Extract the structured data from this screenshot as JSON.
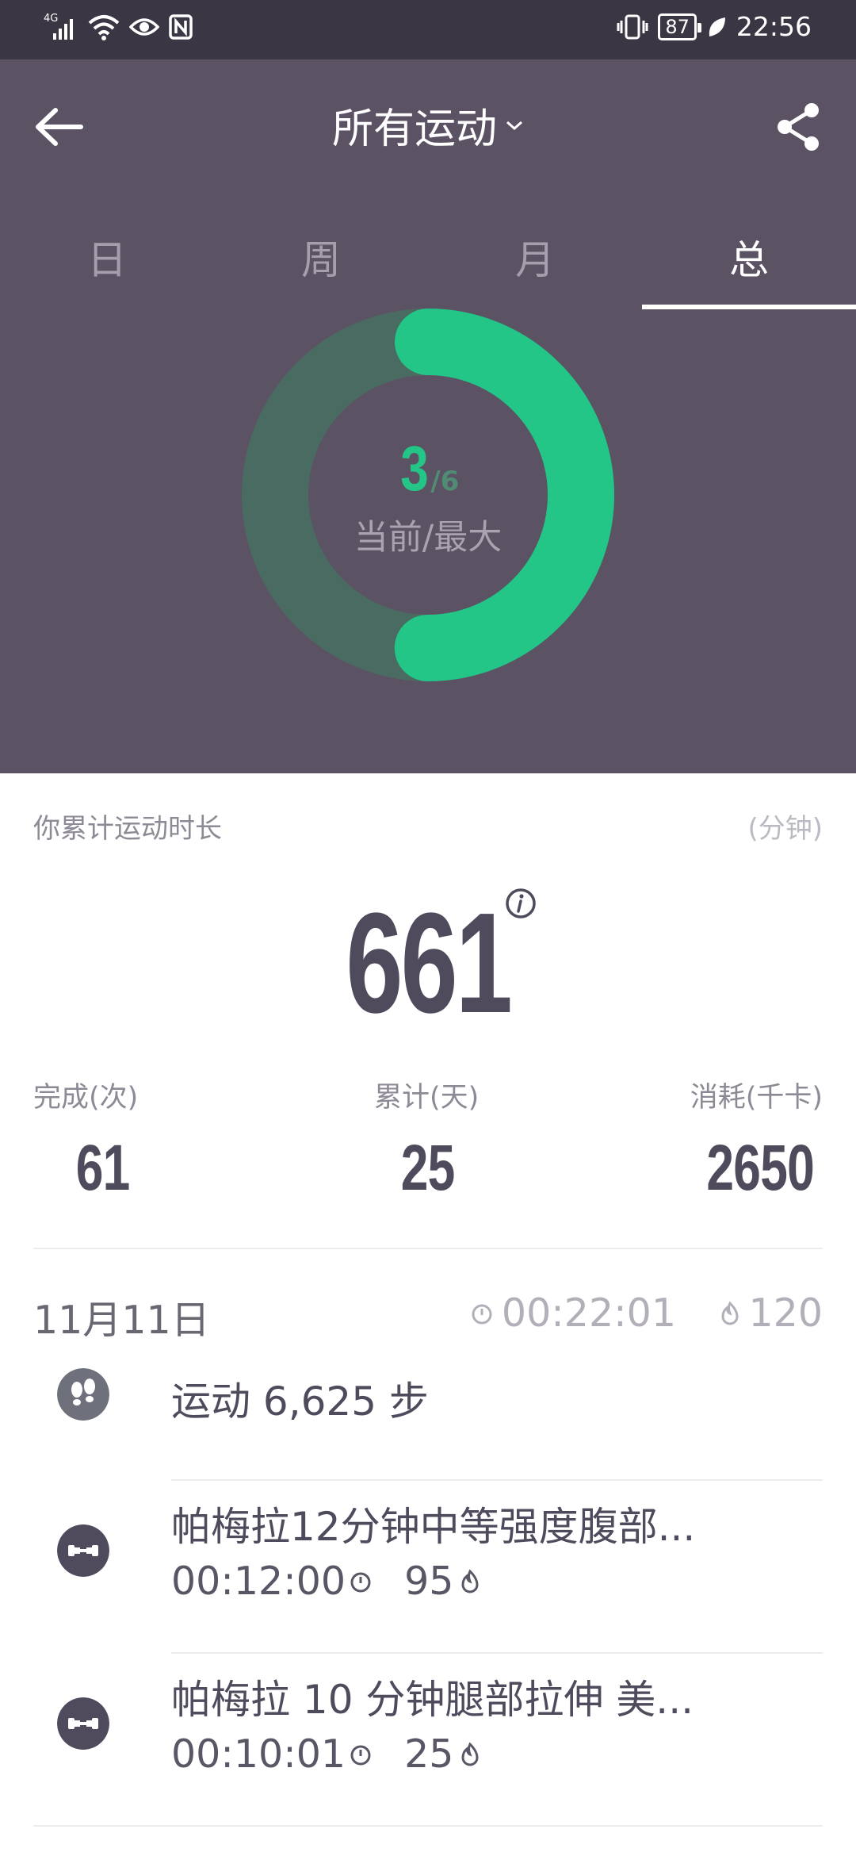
{
  "status_bar": {
    "network": "4G",
    "battery": "87",
    "time": "22:56"
  },
  "header": {
    "title": "所有运动",
    "tabs": [
      {
        "label": "日",
        "active": false
      },
      {
        "label": "周",
        "active": false
      },
      {
        "label": "月",
        "active": false
      },
      {
        "label": "总",
        "active": true
      }
    ]
  },
  "ring": {
    "current": "3",
    "max_text": "/6",
    "current_value": 3,
    "max_value": 6,
    "label": "当前/最大"
  },
  "summary": {
    "duration_label": "你累计运动时长",
    "duration_unit": "(分钟)",
    "total_minutes": "661",
    "stats": [
      {
        "label": "完成(次)",
        "value": "61"
      },
      {
        "label": "累计(天)",
        "value": "25"
      },
      {
        "label": "消耗(千卡)",
        "value": "2650"
      }
    ]
  },
  "day": {
    "date": "11月11日",
    "duration": "00:22:01",
    "calories": "120"
  },
  "activities": [
    {
      "title": "运动 6,625 步",
      "icon": "footsteps-icon"
    },
    {
      "title": "帕梅拉12分钟中等强度腹部...",
      "time": "00:12:00",
      "calories": "95",
      "icon": "dumbbell-icon"
    },
    {
      "title": "帕梅拉 10 分钟腿部拉伸 美...",
      "time": "00:10:01",
      "calories": "25",
      "icon": "dumbbell-icon"
    }
  ],
  "colors": {
    "header_bg": "#5b5263",
    "status_bg": "#3b3644",
    "accent_green": "#24c688",
    "ring_track": "#4a6b62",
    "text_dark": "#4f4a5c"
  }
}
